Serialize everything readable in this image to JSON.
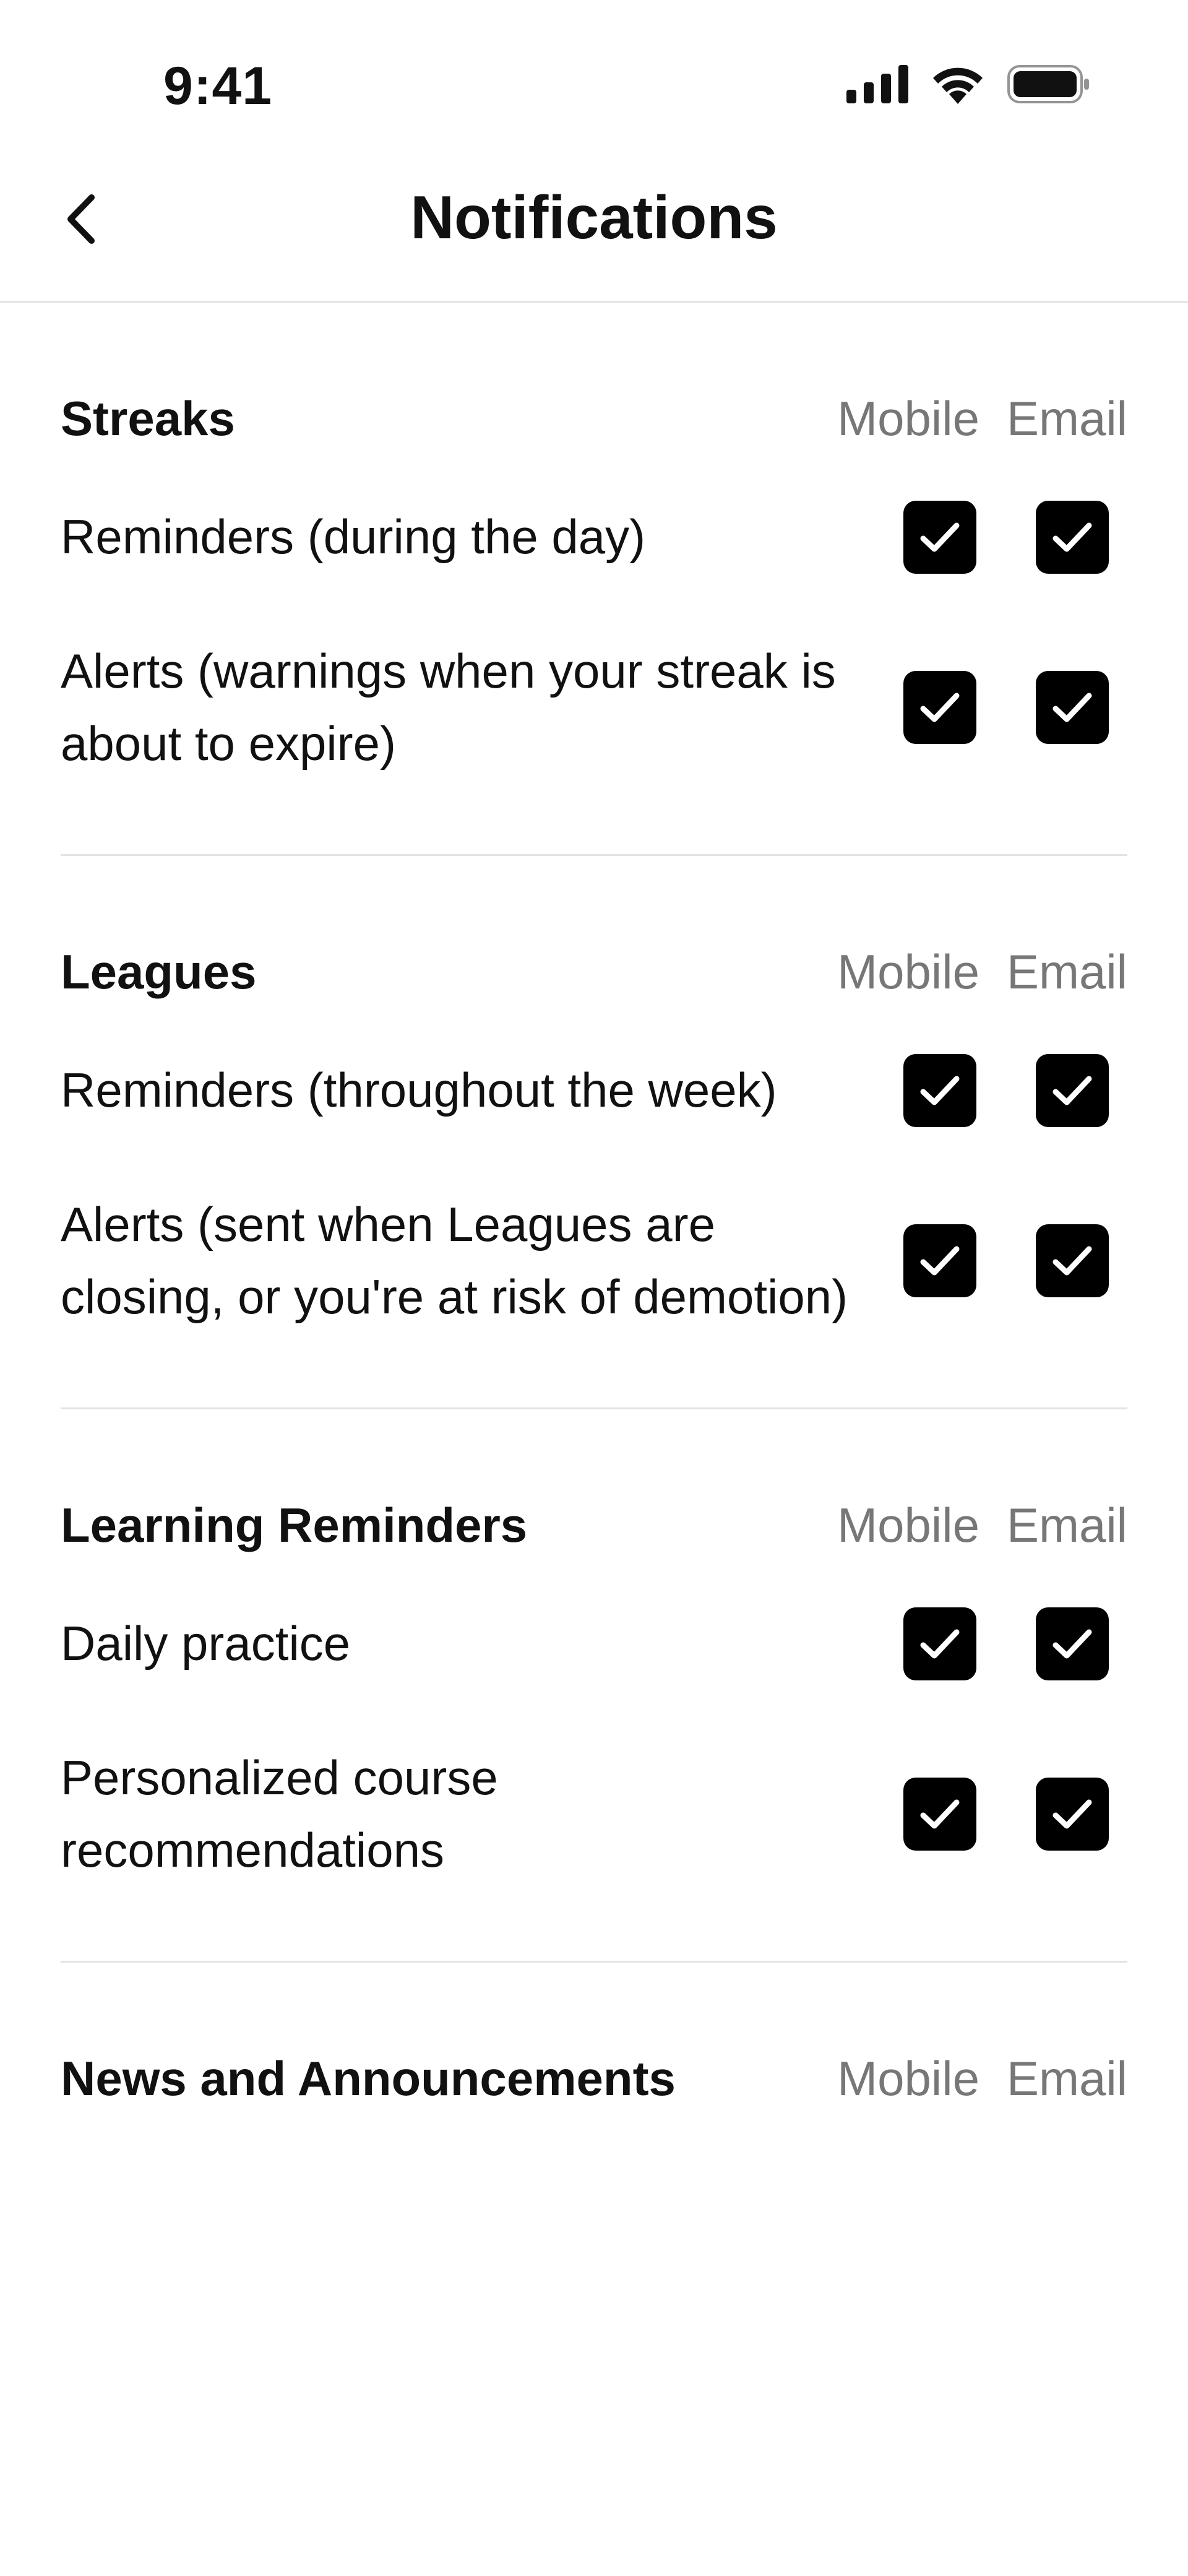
{
  "status_bar": {
    "time": "9:41",
    "icons": [
      "cellular-signal-icon",
      "wifi-icon",
      "battery-icon"
    ]
  },
  "header": {
    "title": "Notifications",
    "back_icon": "chevron-left-icon"
  },
  "columns": {
    "mobile": "Mobile",
    "email": "Email"
  },
  "colors": {
    "checkbox_fill": "#000000",
    "divider": "#e3e3e3",
    "muted_label": "#777777"
  },
  "sections": [
    {
      "title": "Streaks",
      "rows": [
        {
          "label": "Reminders (during the day)",
          "mobile": true,
          "email": true
        },
        {
          "label": "Alerts (warnings when your streak is about to expire)",
          "mobile": true,
          "email": true
        }
      ]
    },
    {
      "title": "Leagues",
      "rows": [
        {
          "label": "Reminders (throughout the week)",
          "mobile": true,
          "email": true
        },
        {
          "label": "Alerts (sent when Leagues are closing, or you're at risk of demotion)",
          "mobile": true,
          "email": true
        }
      ]
    },
    {
      "title": "Learning Reminders",
      "rows": [
        {
          "label": "Daily practice",
          "mobile": true,
          "email": true
        },
        {
          "label": "Personalized course recommendations",
          "mobile": true,
          "email": true
        }
      ]
    },
    {
      "title": "News and Announcements",
      "rows": []
    }
  ]
}
